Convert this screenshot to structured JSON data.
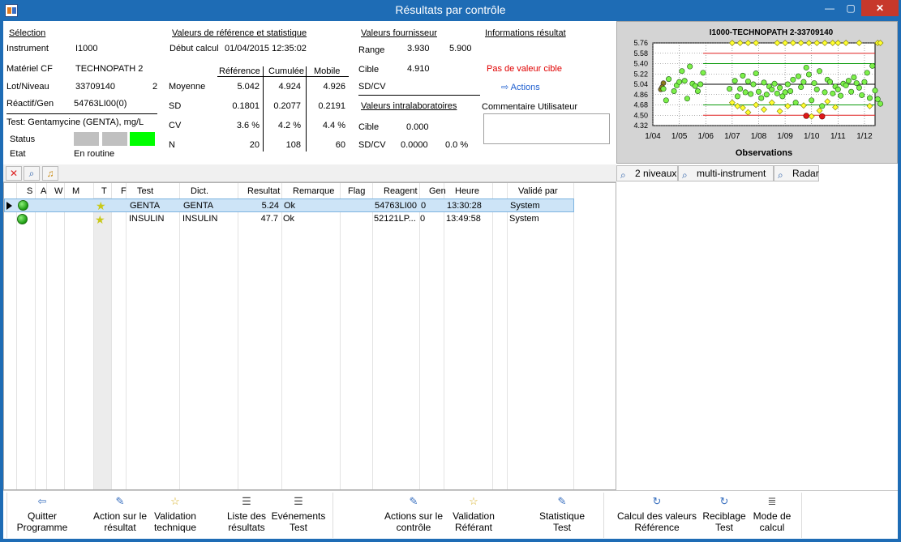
{
  "window": {
    "title": "Résultats par contrôle",
    "minimize": "—",
    "maximize": "▢",
    "close": "✕"
  },
  "selection": {
    "header": "Sélection",
    "instrument_label": "Instrument",
    "instrument_value": "I1000",
    "material_label": "Matériel CF",
    "material_value": "TECHNOPATH 2",
    "lot_label": "Lot/Niveau",
    "lot_value": "33709140",
    "level_value": "2",
    "reagent_label": "Réactif/Gen",
    "reagent_value": "54763LI00(0)",
    "test_label": "Test: Gentamycine (GENTA), mg/L",
    "status_label": "Status",
    "status_colors": [
      "#c0c0c0",
      "#c0c0c0",
      "#00ff00"
    ],
    "state_label": "Etat",
    "state_value": "En routine"
  },
  "reference": {
    "header": "Valeurs de référence et statistique",
    "start_label": "Début calcul",
    "start_value": "01/04/2015 12:35:02",
    "columns": [
      "Référence",
      "Cumulée",
      "Mobile"
    ],
    "rows": [
      {
        "label": "Moyenne",
        "values": [
          "5.042",
          "4.924",
          "4.926"
        ]
      },
      {
        "label": "SD",
        "values": [
          "0.1801",
          "0.2077",
          "0.2191"
        ]
      },
      {
        "label": "CV",
        "values": [
          "3.6 %",
          "4.2 %",
          "4.4 %"
        ]
      },
      {
        "label": "N",
        "values": [
          "20",
          "108",
          "60"
        ]
      }
    ]
  },
  "supplier": {
    "header": "Valeurs fournisseur",
    "range_label": "Range",
    "range_low": "3.930",
    "range_high": "5.900",
    "target_label": "Cible",
    "target_value": "4.910",
    "sdcv_label": "SD/CV"
  },
  "intralab": {
    "header": "Valeurs intralaboratoires",
    "target_label": "Cible",
    "target_value": "0.000",
    "sdcv_label": "SD/CV",
    "sd_value": "0.0000",
    "cv_value": "0.0 %"
  },
  "result_info": {
    "header": "Informations résultat",
    "warning": "Pas de valeur cible",
    "warning_color": "#e00000",
    "actions_link": "Actions",
    "comment_label": "Commentaire Utilisateur"
  },
  "chart_data": {
    "type": "scatter",
    "title": "I1000-TECHNOPATH 2-33709140",
    "xlabel": "Observations",
    "ylabel": "",
    "x_ticks": [
      "1/04",
      "1/05",
      "1/06",
      "1/07",
      "1/08",
      "1/09",
      "1/10",
      "1/11",
      "1/12"
    ],
    "y_ticks": [
      "5.76",
      "5.58",
      "5.40",
      "5.22",
      "5.04",
      "4.86",
      "4.68",
      "4.50",
      "4.32"
    ],
    "ylim": [
      4.32,
      5.76
    ],
    "mean": 5.04,
    "limits_2sd": [
      4.68,
      5.4
    ],
    "limits_3sd": [
      4.5,
      5.58
    ],
    "points_early_olive": [
      {
        "x": 0.3,
        "y": 4.95
      },
      {
        "x": 0.4,
        "y": 5.06
      },
      {
        "x": 0.35,
        "y": 4.99
      }
    ],
    "points_green": [
      {
        "x": 0.4,
        "y": 4.96
      },
      {
        "x": 0.5,
        "y": 4.76
      },
      {
        "x": 0.6,
        "y": 5.13
      },
      {
        "x": 0.8,
        "y": 4.92
      },
      {
        "x": 0.9,
        "y": 5.02
      },
      {
        "x": 1.0,
        "y": 5.08
      },
      {
        "x": 1.1,
        "y": 5.27
      },
      {
        "x": 1.2,
        "y": 5.1
      },
      {
        "x": 1.3,
        "y": 4.79
      },
      {
        "x": 1.4,
        "y": 5.35
      },
      {
        "x": 1.5,
        "y": 5.05
      },
      {
        "x": 1.6,
        "y": 5.01
      },
      {
        "x": 1.7,
        "y": 4.92
      },
      {
        "x": 1.8,
        "y": 5.04
      },
      {
        "x": 1.9,
        "y": 5.24
      },
      {
        "x": 2.9,
        "y": 4.96
      },
      {
        "x": 3.1,
        "y": 5.1
      },
      {
        "x": 3.2,
        "y": 4.83
      },
      {
        "x": 3.3,
        "y": 4.96
      },
      {
        "x": 3.4,
        "y": 5.19
      },
      {
        "x": 3.5,
        "y": 4.9
      },
      {
        "x": 3.6,
        "y": 5.09
      },
      {
        "x": 3.7,
        "y": 4.87
      },
      {
        "x": 3.8,
        "y": 5.04
      },
      {
        "x": 3.9,
        "y": 5.23
      },
      {
        "x": 4.0,
        "y": 4.91
      },
      {
        "x": 4.1,
        "y": 4.8
      },
      {
        "x": 4.2,
        "y": 5.07
      },
      {
        "x": 4.3,
        "y": 4.86
      },
      {
        "x": 4.4,
        "y": 5.0
      },
      {
        "x": 4.5,
        "y": 4.95
      },
      {
        "x": 4.6,
        "y": 5.05
      },
      {
        "x": 4.7,
        "y": 4.88
      },
      {
        "x": 4.8,
        "y": 4.98
      },
      {
        "x": 4.9,
        "y": 4.83
      },
      {
        "x": 5.0,
        "y": 4.9
      },
      {
        "x": 5.1,
        "y": 5.04
      },
      {
        "x": 5.2,
        "y": 4.92
      },
      {
        "x": 5.3,
        "y": 5.12
      },
      {
        "x": 5.4,
        "y": 4.72
      },
      {
        "x": 5.5,
        "y": 5.18
      },
      {
        "x": 5.6,
        "y": 4.99
      },
      {
        "x": 5.7,
        "y": 5.08
      },
      {
        "x": 5.8,
        "y": 5.33
      },
      {
        "x": 5.9,
        "y": 5.21
      },
      {
        "x": 6.0,
        "y": 4.76
      },
      {
        "x": 6.1,
        "y": 5.06
      },
      {
        "x": 6.2,
        "y": 4.95
      },
      {
        "x": 6.3,
        "y": 5.27
      },
      {
        "x": 6.4,
        "y": 4.66
      },
      {
        "x": 6.5,
        "y": 4.9
      },
      {
        "x": 6.6,
        "y": 5.12
      },
      {
        "x": 6.7,
        "y": 5.08
      },
      {
        "x": 6.8,
        "y": 4.88
      },
      {
        "x": 6.9,
        "y": 5.0
      },
      {
        "x": 7.0,
        "y": 4.95
      },
      {
        "x": 7.1,
        "y": 4.84
      },
      {
        "x": 7.2,
        "y": 5.05
      },
      {
        "x": 7.3,
        "y": 5.02
      },
      {
        "x": 7.4,
        "y": 5.1
      },
      {
        "x": 7.5,
        "y": 4.91
      },
      {
        "x": 7.6,
        "y": 5.16
      },
      {
        "x": 7.7,
        "y": 5.06
      },
      {
        "x": 7.8,
        "y": 4.98
      },
      {
        "x": 7.9,
        "y": 4.85
      },
      {
        "x": 8.0,
        "y": 5.08
      },
      {
        "x": 8.1,
        "y": 5.24
      },
      {
        "x": 8.2,
        "y": 4.8
      },
      {
        "x": 8.3,
        "y": 5.36
      },
      {
        "x": 8.4,
        "y": 4.93
      },
      {
        "x": 8.5,
        "y": 4.78
      },
      {
        "x": 8.6,
        "y": 4.7
      }
    ],
    "points_yellow": [
      {
        "x": 3.0,
        "y": 5.76
      },
      {
        "x": 3.3,
        "y": 5.76
      },
      {
        "x": 3.6,
        "y": 5.76
      },
      {
        "x": 3.9,
        "y": 5.76
      },
      {
        "x": 4.7,
        "y": 5.76
      },
      {
        "x": 5.0,
        "y": 5.76
      },
      {
        "x": 5.3,
        "y": 5.76
      },
      {
        "x": 5.6,
        "y": 5.76
      },
      {
        "x": 5.9,
        "y": 5.76
      },
      {
        "x": 6.2,
        "y": 5.76
      },
      {
        "x": 6.5,
        "y": 5.76
      },
      {
        "x": 6.8,
        "y": 5.76
      },
      {
        "x": 7.0,
        "y": 5.76
      },
      {
        "x": 7.3,
        "y": 5.76
      },
      {
        "x": 7.8,
        "y": 5.76
      },
      {
        "x": 8.5,
        "y": 5.76
      },
      {
        "x": 8.6,
        "y": 5.76
      },
      {
        "x": 3.0,
        "y": 4.72
      },
      {
        "x": 3.2,
        "y": 4.66
      },
      {
        "x": 3.4,
        "y": 4.63
      },
      {
        "x": 3.6,
        "y": 4.55
      },
      {
        "x": 3.9,
        "y": 4.68
      },
      {
        "x": 4.2,
        "y": 4.6
      },
      {
        "x": 4.5,
        "y": 4.72
      },
      {
        "x": 4.8,
        "y": 4.57
      },
      {
        "x": 5.1,
        "y": 4.66
      },
      {
        "x": 5.7,
        "y": 4.67
      },
      {
        "x": 6.0,
        "y": 4.48
      },
      {
        "x": 6.3,
        "y": 4.58
      },
      {
        "x": 6.6,
        "y": 4.74
      },
      {
        "x": 6.9,
        "y": 4.64
      },
      {
        "x": 8.2,
        "y": 4.66
      }
    ],
    "points_red": [
      {
        "x": 5.8,
        "y": 4.49
      },
      {
        "x": 6.4,
        "y": 4.48
      }
    ],
    "grid": true
  },
  "toolbar": {
    "delete_icon": "delete-icon",
    "zoom_icon": "zoom-icon",
    "bell_icon": "bell-icon",
    "two_levels": "2 niveaux",
    "multi_instrument": "multi-instrument",
    "radar": "Radar"
  },
  "grid": {
    "columns": [
      "S",
      "A",
      "W",
      "M",
      "T",
      "F",
      "Test",
      "Dict.",
      "Resultat",
      "Remarque",
      "Flag",
      "Reagent",
      "Gen",
      "Heure",
      "Validé par"
    ],
    "rows": [
      {
        "test": "GENTA",
        "dict": "GENTA",
        "result": "5.24",
        "remark": "Ok",
        "flag": "",
        "reagent": "54763LI00",
        "gen": "0",
        "time": "13:30:28",
        "validated_by": "System"
      },
      {
        "test": "INSULIN",
        "dict": "INSULIN",
        "result": "47.7",
        "remark": "Ok",
        "flag": "",
        "reagent": "52121LP...",
        "gen": "0",
        "time": "13:49:58",
        "validated_by": "System"
      }
    ]
  },
  "bottom": {
    "quit": "Quitter\nProgramme",
    "action_result": "Action sur le\nrésultat",
    "tech_validation": "Validation\ntechnique",
    "results_list": "Liste des\nrésultats",
    "test_events": "Evénements\nTest",
    "control_actions": "Actions sur le\ncontrôle",
    "referent_validation": "Validation\nRéférant",
    "test_statistics": "Statistique\nTest",
    "calc_ref_values": "Calcul des valeurs\nRéférence",
    "test_retarget": "Reciblage\nTest",
    "calc_mode": "Mode de\ncalcul"
  }
}
